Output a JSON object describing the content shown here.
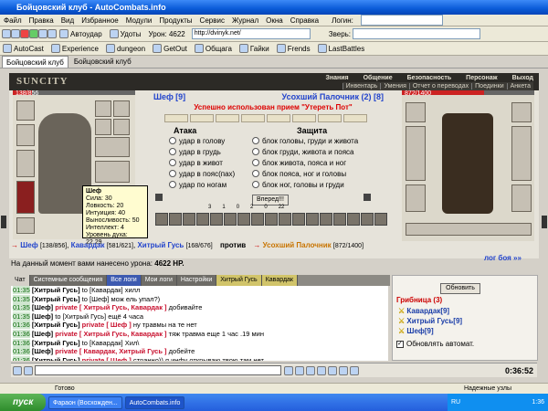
{
  "window": {
    "title": "Бойцовский клуб - AutoCombats.info",
    "btn_min": "_",
    "btn_max": "□",
    "btn_close": "×"
  },
  "menu": [
    "Файл",
    "Правка",
    "Вид",
    "Избранное",
    "Модули",
    "Продукты",
    "Сервис",
    "Журнал",
    "Окна",
    "Справка"
  ],
  "login_label": "Логин:",
  "toolbar": {
    "autoudar": "Автоудар",
    "udoty": "Удоты",
    "uron": "Урон: 4622",
    "address": "http://dvinyk.net/",
    "zver_label": "Зверь:"
  },
  "links": [
    "AutoCast",
    "Experience",
    "dungeon",
    "GetOut",
    "Общага",
    "Гайки",
    "Frends",
    "LastBattles"
  ],
  "tabs": [
    "Бойцовский клуб",
    "Бойцовский клуб"
  ],
  "game_nav": {
    "logo": "SUNCITY",
    "top": [
      "Знания",
      "Общение",
      "Безопасность",
      "Персонаж",
      "Выход"
    ],
    "sub": [
      "Инвентарь",
      "Умения",
      "Отчет о переводах",
      "Поединки",
      "Анкета"
    ]
  },
  "player": {
    "name": "Шеф",
    "level": "[9]",
    "hp": "138/856",
    "hp_frac": 0.16
  },
  "opponent": {
    "name": "Усохший Палочник",
    "level": "(2)",
    "level2": "[8]",
    "hp": "872/1400",
    "hp_frac": 0.62
  },
  "message": "Успешно использован прием \"Утереть Пот\"",
  "attack": {
    "title": "Атака",
    "options": [
      "удар в голову",
      "удар в грудь",
      "удар в живот",
      "удар в пояс(пах)",
      "удар по ногам"
    ]
  },
  "defense": {
    "title": "Защита",
    "options": [
      "блок головы, груди и живота",
      "блок груди, живота и пояса",
      "блок живота, пояса и ног",
      "блок пояса, ног и головы",
      "блок ног, головы и груди"
    ]
  },
  "forward_button": "Вперед!!!",
  "skill_counts": [
    "3",
    "1",
    "0",
    "2",
    "0",
    "22"
  ],
  "tooltip": {
    "name": "Шеф",
    "lines": [
      "Сила: 30",
      "Ловкость: 20",
      "Интуиция: 40",
      "Выносливость: 50",
      "Интеллект: 4"
    ],
    "level": "Уровень духа: 22.29"
  },
  "vs_line": {
    "left_name": "Шеф",
    "left_hp": "[138/856]",
    "mid1_name": "Кавардак",
    "mid1_hp": "[581/621]",
    "mid2_name": "Хитрый Гусь",
    "mid2_hp": "[168/676]",
    "vs": "против",
    "right_name": "Усохший Палочник",
    "right_hp": "[872/1400]",
    "log": "лог боя »»"
  },
  "damage": {
    "text": "На данный момент вами нанесено урона:",
    "value": "4622 HP."
  },
  "chat_tabs": [
    "Чат",
    "Системные сообщения",
    "Все логи",
    "Мои логи",
    "Настройки",
    "Хитрый Гусь",
    "Кавардак"
  ],
  "chat": [
    {
      "t": "01:35",
      "from": "[Хитрый Гусь]",
      "priv": "",
      "to": "to [Кавардак]",
      "msg": "хилл"
    },
    {
      "t": "01:35",
      "from": "[Хитрый Гусь]",
      "priv": "",
      "to": "to [Шеф]",
      "msg": "мож ель упал?)"
    },
    {
      "t": "01:35",
      "from": "[Шеф]",
      "priv": "private [ Хитрый Гусь, Кавардак ]",
      "to": "",
      "msg": "добивайте"
    },
    {
      "t": "01:35",
      "from": "[Шеф]",
      "priv": "",
      "to": "to [Хитрый Гусь]",
      "msg": "ещё 4 часа"
    },
    {
      "t": "01:36",
      "from": "[Хитрый Гусь]",
      "priv": "private [ Шеф ]",
      "to": "",
      "msg": "ну травмы на те нет"
    },
    {
      "t": "01:36",
      "from": "[Шеф]",
      "priv": "private [ Хитрый Гусь, Кавардак ]",
      "to": "",
      "msg": "тяж травма еще 1 час .19 мин"
    },
    {
      "t": "01:36",
      "from": "[Хитрый Гусь]",
      "priv": "",
      "to": "to [Кавардак]",
      "msg": "Хил\\"
    },
    {
      "t": "01:36",
      "from": "[Шеф]",
      "priv": "private [ Кавардак, Хитрый Гусь ]",
      "to": "",
      "msg": "добейте"
    },
    {
      "t": "01:36",
      "from": "[Хитрый Гусь]",
      "priv": "private [ Шеф ]",
      "to": "",
      "msg": "странно)) я инфу открываю твою там нет"
    }
  ],
  "right_panel": {
    "refresh": "Обновить",
    "title": "Грибница (3)",
    "members": [
      "Кавардак[9]",
      "Хитрый Гусь[9]",
      "Шеф[9]"
    ],
    "auto": "Обновлять автомат."
  },
  "clock": "0:36:52",
  "status": {
    "left": "Готово",
    "right": "Надежные узлы"
  },
  "taskbar": {
    "start": "пуск",
    "items": [
      "Фараон (Восхожден...",
      "AutoCombats.info"
    ],
    "tray": "RU",
    "time": "1:36"
  }
}
